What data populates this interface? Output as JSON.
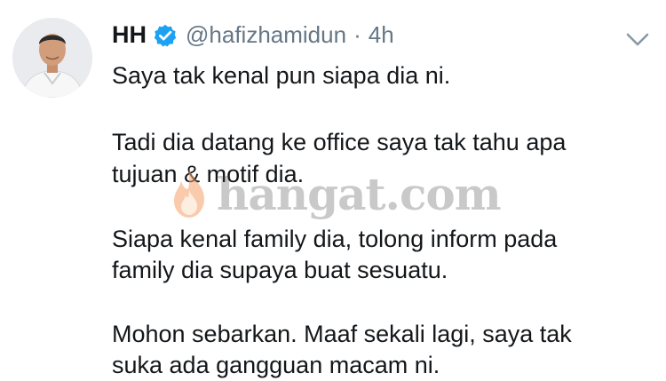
{
  "tweet": {
    "display_name": "HH",
    "handle": "@hafizhamidun",
    "separator": "·",
    "time": "4h",
    "lines": [
      "Saya tak kenal pun siapa dia ni.",
      "Tadi dia datang ke office saya tak tahu apa",
      "tujuan & motif dia.",
      "Siapa kenal family dia, tolong inform pada",
      "family dia supaya buat sesuatu.",
      "Mohon sebarkan. Maaf sekali lagi, saya tak",
      "suka ada gangguan macam ni."
    ]
  },
  "watermark": {
    "text": "hangat.com"
  },
  "icons": {
    "avatar": "user-avatar",
    "verified": "verified-badge-icon",
    "menu": "chevron-down-icon",
    "watermark_logo": "flame-icon"
  },
  "colors": {
    "text": "#14171a",
    "secondary": "#657786",
    "verified": "#1da1f2",
    "chevron": "#8899a6"
  }
}
